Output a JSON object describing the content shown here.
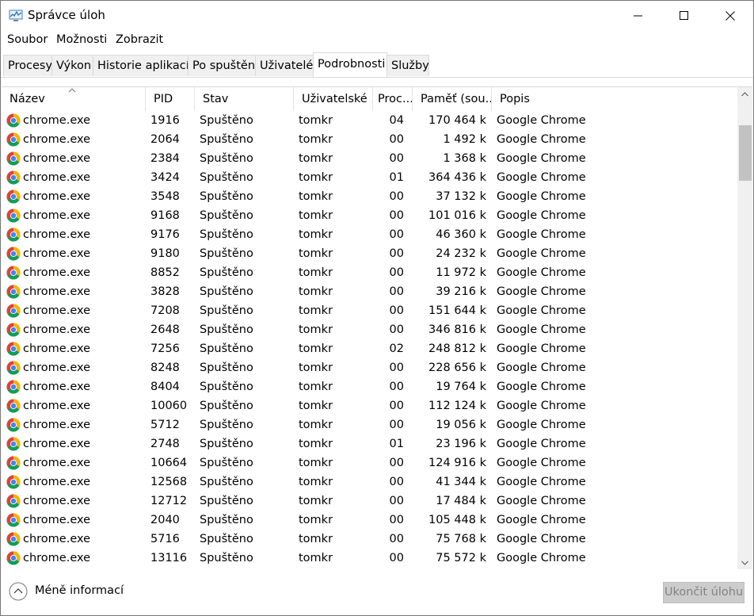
{
  "window": {
    "title": "Správce úloh",
    "icon": "task-manager-icon"
  },
  "menu": {
    "items": [
      "Soubor",
      "Možnosti",
      "Zobrazit"
    ]
  },
  "tabs": {
    "items": [
      "Procesy",
      "Výkon",
      "Historie aplikací",
      "Po spuštění",
      "Uživatelé",
      "Podrobnosti",
      "Služby"
    ],
    "active": "Podrobnosti"
  },
  "table": {
    "columns": [
      "Název",
      "PID",
      "Stav",
      "Uživatelské ...",
      "Proc...",
      "Paměť (sou...",
      "Popis"
    ],
    "sorted_column": "Název",
    "rows": [
      {
        "name": "chrome.exe",
        "pid": "1916",
        "status": "Spuštěno",
        "user": "tomkr",
        "cpu": "04",
        "memory": "170 464 k",
        "description": "Google Chrome"
      },
      {
        "name": "chrome.exe",
        "pid": "2064",
        "status": "Spuštěno",
        "user": "tomkr",
        "cpu": "00",
        "memory": "1 492 k",
        "description": "Google Chrome"
      },
      {
        "name": "chrome.exe",
        "pid": "2384",
        "status": "Spuštěno",
        "user": "tomkr",
        "cpu": "00",
        "memory": "1 368 k",
        "description": "Google Chrome"
      },
      {
        "name": "chrome.exe",
        "pid": "3424",
        "status": "Spuštěno",
        "user": "tomkr",
        "cpu": "01",
        "memory": "364 436 k",
        "description": "Google Chrome"
      },
      {
        "name": "chrome.exe",
        "pid": "3548",
        "status": "Spuštěno",
        "user": "tomkr",
        "cpu": "00",
        "memory": "37 132 k",
        "description": "Google Chrome"
      },
      {
        "name": "chrome.exe",
        "pid": "9168",
        "status": "Spuštěno",
        "user": "tomkr",
        "cpu": "00",
        "memory": "101 016 k",
        "description": "Google Chrome"
      },
      {
        "name": "chrome.exe",
        "pid": "9176",
        "status": "Spuštěno",
        "user": "tomkr",
        "cpu": "00",
        "memory": "46 360 k",
        "description": "Google Chrome"
      },
      {
        "name": "chrome.exe",
        "pid": "9180",
        "status": "Spuštěno",
        "user": "tomkr",
        "cpu": "00",
        "memory": "24 232 k",
        "description": "Google Chrome"
      },
      {
        "name": "chrome.exe",
        "pid": "8852",
        "status": "Spuštěno",
        "user": "tomkr",
        "cpu": "00",
        "memory": "11 972 k",
        "description": "Google Chrome"
      },
      {
        "name": "chrome.exe",
        "pid": "3828",
        "status": "Spuštěno",
        "user": "tomkr",
        "cpu": "00",
        "memory": "39 216 k",
        "description": "Google Chrome"
      },
      {
        "name": "chrome.exe",
        "pid": "7208",
        "status": "Spuštěno",
        "user": "tomkr",
        "cpu": "00",
        "memory": "151 644 k",
        "description": "Google Chrome"
      },
      {
        "name": "chrome.exe",
        "pid": "2648",
        "status": "Spuštěno",
        "user": "tomkr",
        "cpu": "00",
        "memory": "346 816 k",
        "description": "Google Chrome"
      },
      {
        "name": "chrome.exe",
        "pid": "7256",
        "status": "Spuštěno",
        "user": "tomkr",
        "cpu": "02",
        "memory": "248 812 k",
        "description": "Google Chrome"
      },
      {
        "name": "chrome.exe",
        "pid": "8248",
        "status": "Spuštěno",
        "user": "tomkr",
        "cpu": "00",
        "memory": "228 656 k",
        "description": "Google Chrome"
      },
      {
        "name": "chrome.exe",
        "pid": "8404",
        "status": "Spuštěno",
        "user": "tomkr",
        "cpu": "00",
        "memory": "19 764 k",
        "description": "Google Chrome"
      },
      {
        "name": "chrome.exe",
        "pid": "10060",
        "status": "Spuštěno",
        "user": "tomkr",
        "cpu": "00",
        "memory": "112 124 k",
        "description": "Google Chrome"
      },
      {
        "name": "chrome.exe",
        "pid": "5712",
        "status": "Spuštěno",
        "user": "tomkr",
        "cpu": "00",
        "memory": "19 056 k",
        "description": "Google Chrome"
      },
      {
        "name": "chrome.exe",
        "pid": "2748",
        "status": "Spuštěno",
        "user": "tomkr",
        "cpu": "01",
        "memory": "23 196 k",
        "description": "Google Chrome"
      },
      {
        "name": "chrome.exe",
        "pid": "10664",
        "status": "Spuštěno",
        "user": "tomkr",
        "cpu": "00",
        "memory": "124 916 k",
        "description": "Google Chrome"
      },
      {
        "name": "chrome.exe",
        "pid": "12568",
        "status": "Spuštěno",
        "user": "tomkr",
        "cpu": "00",
        "memory": "41 344 k",
        "description": "Google Chrome"
      },
      {
        "name": "chrome.exe",
        "pid": "12712",
        "status": "Spuštěno",
        "user": "tomkr",
        "cpu": "00",
        "memory": "17 484 k",
        "description": "Google Chrome"
      },
      {
        "name": "chrome.exe",
        "pid": "2040",
        "status": "Spuštěno",
        "user": "tomkr",
        "cpu": "00",
        "memory": "105 448 k",
        "description": "Google Chrome"
      },
      {
        "name": "chrome.exe",
        "pid": "5716",
        "status": "Spuštěno",
        "user": "tomkr",
        "cpu": "00",
        "memory": "75 768 k",
        "description": "Google Chrome"
      },
      {
        "name": "chrome.exe",
        "pid": "13116",
        "status": "Spuštěno",
        "user": "tomkr",
        "cpu": "00",
        "memory": "75 572 k",
        "description": "Google Chrome"
      }
    ]
  },
  "footer": {
    "less_details": "Méně informací",
    "end_task": "Ukončit úlohu"
  },
  "colors": {
    "end_task_bg": "#cccccc",
    "end_task_text": "#838383",
    "tab_inactive_bg": "#f0f0f0",
    "scroll_thumb": "#c2c2c2"
  }
}
